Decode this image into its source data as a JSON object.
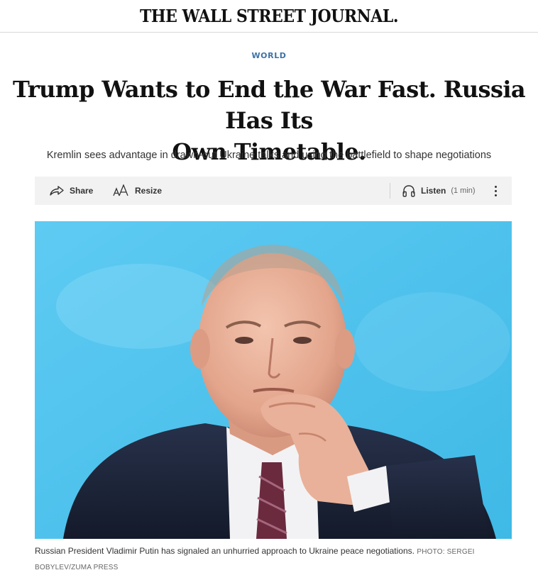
{
  "masthead": {
    "logo": "THE WALL STREET JOURNAL."
  },
  "article": {
    "section": "WORLD",
    "headline_line1": "Trump Wants to End the War Fast. Russia Has Its",
    "headline_line2": "Own Timetable.",
    "dek": "Kremlin sees advantage in drawn-out Ukraine talks and using the battlefield to shape negotiations"
  },
  "toolbar": {
    "share_label": "Share",
    "resize_label": "Resize",
    "listen_label": "Listen",
    "listen_duration": "(1 min)",
    "icons": {
      "share": "share-arrow-icon",
      "resize": "text-resize-icon",
      "listen": "headphones-icon",
      "more": "more-vertical-icon"
    }
  },
  "photo": {
    "caption": "Russian President Vladimir Putin has signaled an unhurried approach to Ukraine peace negotiations.",
    "credit": "PHOTO: SERGEI BOBYLEV/ZUMA PRESS"
  },
  "colors": {
    "section_link": "#3f72a6",
    "toolbar_bg": "#f2f2f2",
    "photo_background": "#4fc4ee"
  }
}
